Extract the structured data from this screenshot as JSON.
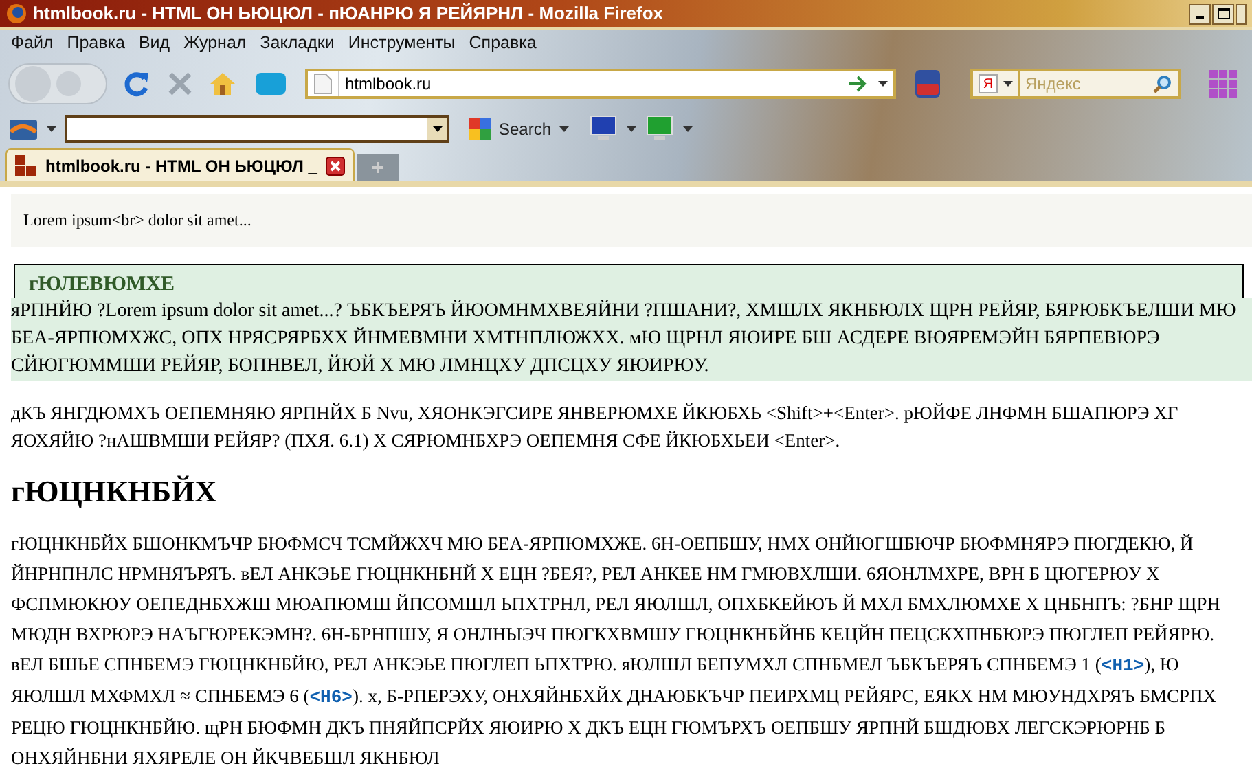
{
  "window": {
    "title": "htmlbook.ru - HTML ОН ЬЮЦЮЛ - пЮАНРЮ Я РЕЙЯРНЛ - Mozilla Firefox"
  },
  "menu": [
    "Файл",
    "Правка",
    "Вид",
    "Журнал",
    "Закладки",
    "Инструменты",
    "Справка"
  ],
  "address_bar": {
    "value": "htmlbook.ru"
  },
  "search_toolbar": {
    "search_label": "Search"
  },
  "yandex_search": {
    "engine_letter": "Я",
    "placeholder": "Яндекс"
  },
  "tabs": [
    {
      "label": "htmlbook.ru - HTML ОН ЬЮЦЮЛ _",
      "selected": true
    }
  ],
  "page": {
    "code_example": "Lorem ipsum<br> dolor sit amet...",
    "note": {
      "heading": "гЮЛЕВЮМХЕ",
      "text": "яРПНЙЮ ?Lorem ipsum dolor sit amet...? ЪБКЪЕРЯЪ ЙЮОМНМХВЕЯЙНИ ?ПШАНИ?, ХМШЛХ ЯКНБЮЛХ ЩРН РЕЙЯР, БЯРЮБКЪЕЛШИ МЮ БЕА-ЯРПЮМХЖС, ОПХ НРЯСРЯРБХХ ЙНМЕВМНИ ХМТНПЛЮЖХХ. мЮ ЩРНЛ ЯЮИРЕ БШ АСДЕРЕ ВЮЯРЕМЭЙН БЯРПЕВЮРЭ СЙЮГЮММШИ РЕЙЯР, БОПНВЕЛ, ЙЮЙ Х МЮ ЛМНЦХУ ДПСЦХУ ЯЮИРЮУ."
    },
    "paragraph": "дКЪ ЯНГДЮМХЪ ОЕПЕМНЯЮ ЯРПНЙХ Б Nvu, ХЯОНКЭГСИРЕ ЯНВЕРЮМХЕ ЙКЮБХЬ <Shift>+<Enter>. рЮЙФЕ ЛНФМН БШАПЮРЭ ХГ ЯОХЯЙЮ ?нАШВМШИ РЕЙЯР? (ПХЯ. 6.1) Х СЯРЮМНБХРЭ ОЕПЕМНЯ СФЕ ЙКЮБХЬЕИ <Enter>.",
    "heading": "гЮЦНКНБЙХ",
    "body": [
      {
        "kind": "text",
        "text": "гЮЦНКНБЙХ БШОНКМЪЧР БЮФМСЧ ТСМЙЖХЧ МЮ БЕА-ЯРПЮМХЖЕ. 6Н-ОЕПБШУ, НМХ ОНЙЮГШБЮЧР БЮФМНЯРЭ ПЮГДЕКЮ, Й ЙНРНПНЛС НРМНЯЪРЯЪ. вЕЛ АНКЭЬЕ ГЮЦНКНБНЙ Х ЕЦН ?БЕЯ?, РЕЛ АНКЕЕ НМ ГМЮВХЛШИ. 6ЯОНЛМХРЕ, ВРН Б ЦЮГЕРЮУ Х ФСПМЮКЮУ ОЕПЕДНБХЖШ МЮАПЮМШ ЙПСОМШЛ ЬПХТРНЛ, РЕЛ ЯЮЛШЛ, ОПХБКЕЙЮЪ Й МХЛ БМХЛЮМХЕ Х ЦНБНПЪ: ?БНР ЩРН МЮДН ВХРЮРЭ НАЪГЮРЕКЭМН?. 6Н-БРНПШУ, Я ОНЛНЫЭЧ ПЮГКХВМШУ ГЮЦНКНБЙНБ КЕЦЙН ПЕЦСКХПНБЮРЭ ПЮГЛЕП РЕЙЯРЮ. вЕЛ БШЬЕ СПНБЕМЭ ГЮЦНКНБЙЮ, РЕЛ АНКЭЬЕ ПЮГЛЕП ЬПХТРЮ. яЮЛШЛ БЕПУМХЛ СПНБМЕЛ ЪБКЪЕРЯЪ СПНБЕМЭ 1 ("
      },
      {
        "kind": "code",
        "text": "<H1>"
      },
      {
        "kind": "text",
        "text": "), Ю ЯЮЛШЛ МХФМХЛ ≈ СПНБЕМЭ 6 ("
      },
      {
        "kind": "code",
        "text": "<H6>"
      },
      {
        "kind": "text",
        "text": "). х, Б-РПЕРЭХУ, ОНХЯЙНБХЙХ ДНАЮБКЪЧР ПЕИРХМЦ РЕЙЯРС, ЕЯКХ НМ МЮУНДХРЯЪ БМСРПХ РЕЦЮ ГЮЦНКНБЙЮ. щРН БЮФМН ДКЪ ПНЯЙПСРЙХ ЯЮИРЮ Х ДКЪ ЕЦН ГЮМЪРХЪ ОЕПБШУ ЯРПНЙ БШДЮВХ ЛЕГСКЭРЮРНБ Б ОНХЯЙНБНИ ЯХЯРЕЛЕ ОН ЙКЧВЕБШЛ ЯКНБЮЛ"
      }
    ]
  }
}
